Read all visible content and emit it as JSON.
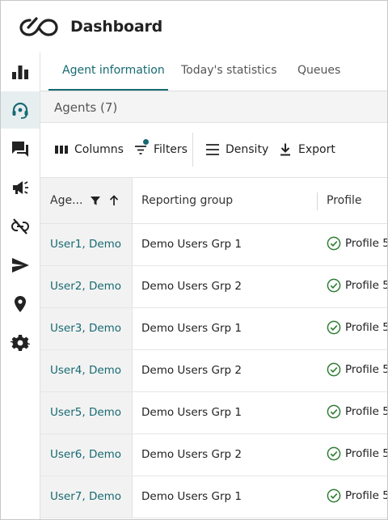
{
  "app": {
    "title": "Dashboard",
    "logo_icon": "infinity-logo-icon"
  },
  "sidebar": {
    "items": [
      {
        "name": "chart",
        "icon": "bar-chart-icon"
      },
      {
        "name": "agents",
        "icon": "headset-icon",
        "active": true
      },
      {
        "name": "messages",
        "icon": "chat-icon"
      },
      {
        "name": "announcements",
        "icon": "megaphone-icon"
      },
      {
        "name": "unlink",
        "icon": "link-off-icon"
      },
      {
        "name": "send",
        "icon": "send-icon"
      },
      {
        "name": "location",
        "icon": "location-pin-icon"
      },
      {
        "name": "settings",
        "icon": "gear-icon"
      }
    ]
  },
  "tabs": [
    {
      "label": "Agent information",
      "active": true
    },
    {
      "label": "Today's statistics"
    },
    {
      "label": "Queues"
    }
  ],
  "agents": {
    "title": "Agents (7)"
  },
  "toolbar": {
    "columns_label": "Columns",
    "filters_label": "Filters",
    "density_label": "Density",
    "export_label": "Export"
  },
  "grid": {
    "headers": [
      "Age...",
      "Reporting group",
      "Profile"
    ],
    "rows": [
      {
        "name": "User1, Demo",
        "group": "Demo Users Grp 1",
        "profile": "Profile 5"
      },
      {
        "name": "User2, Demo",
        "group": "Demo Users Grp 2",
        "profile": "Profile 5"
      },
      {
        "name": "User3, Demo",
        "group": "Demo Users Grp 1",
        "profile": "Profile 5"
      },
      {
        "name": "User4, Demo",
        "group": "Demo Users Grp 2",
        "profile": "Profile 5"
      },
      {
        "name": "User5, Demo",
        "group": "Demo Users Grp 1",
        "profile": "Profile 5"
      },
      {
        "name": "User6, Demo",
        "group": "Demo Users Grp 2",
        "profile": "Profile 5"
      },
      {
        "name": "User7, Demo",
        "group": "Demo Users Grp 1",
        "profile": "Profile 5"
      }
    ]
  },
  "colors": {
    "accent": "#176a72",
    "icon": "#222222",
    "check": "#2e7d32"
  }
}
